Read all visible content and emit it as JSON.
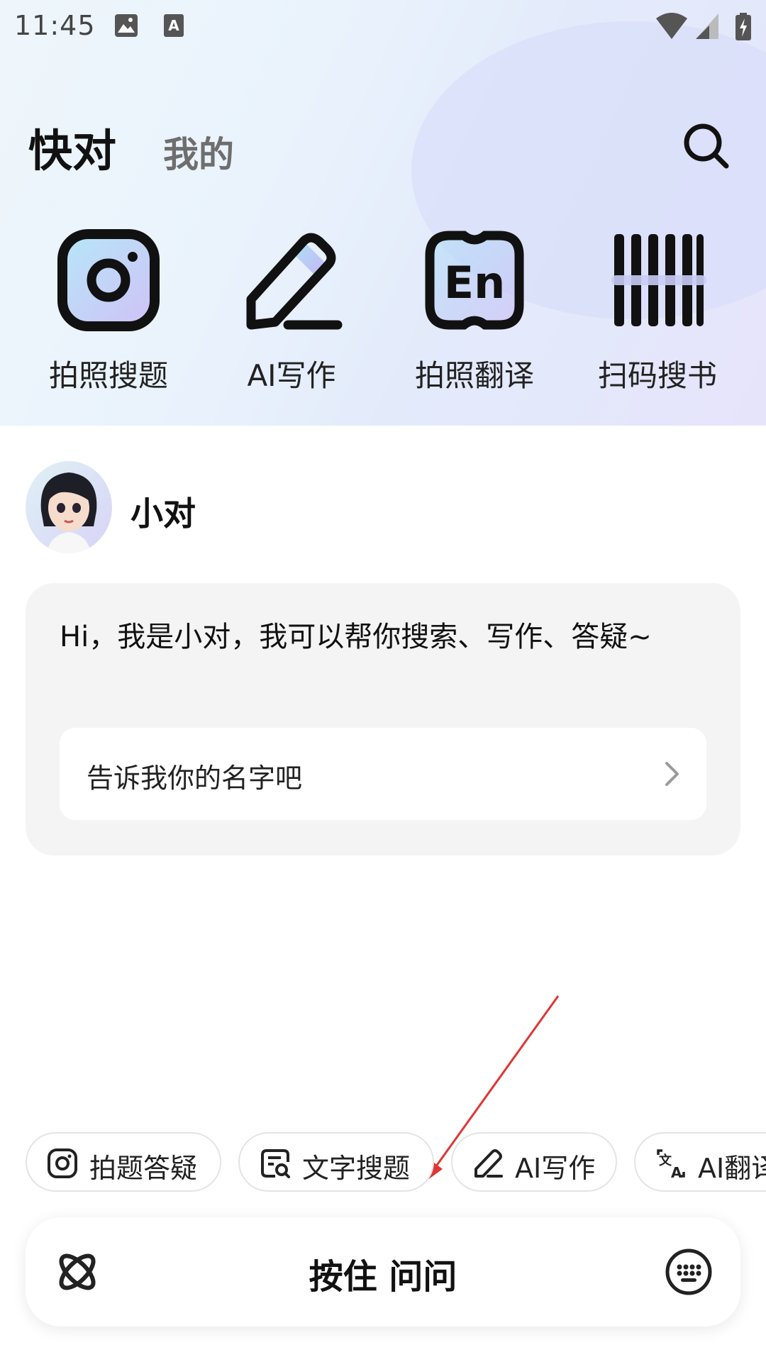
{
  "status_bar": {
    "time": "11:45",
    "icons": [
      "image-icon",
      "text-a-icon",
      "wifi-icon",
      "cellular-icon",
      "battery-charging-icon"
    ]
  },
  "header": {
    "tab_active": "快对",
    "tab_inactive": "我的",
    "search_icon": "search-icon"
  },
  "tools": [
    {
      "label": "拍照搜题",
      "icon": "camera-icon"
    },
    {
      "label": "AI写作",
      "icon": "pencil-icon"
    },
    {
      "label": "拍照翻译",
      "icon": "translate-en-icon"
    },
    {
      "label": "扫码搜书",
      "icon": "barcode-icon"
    }
  ],
  "bot": {
    "name": "小对",
    "greeting": "Hi，我是小对，我可以帮你搜索、写作、答疑~",
    "suggestion": "告诉我你的名字吧"
  },
  "chips": [
    {
      "label": "拍题答疑",
      "icon": "camera-icon"
    },
    {
      "label": "文字搜题",
      "icon": "text-search-icon"
    },
    {
      "label": "AI写作",
      "icon": "pencil-icon"
    },
    {
      "label": "AI翻译",
      "icon": "translate-icon"
    }
  ],
  "voice_bar": {
    "label": "按住 问问",
    "left_icon": "atom-icon",
    "right_icon": "keyboard-icon"
  },
  "colors": {
    "accent_gradient": [
      "#a9d8f5",
      "#c9b6f5"
    ],
    "arrow": "#e03535"
  }
}
